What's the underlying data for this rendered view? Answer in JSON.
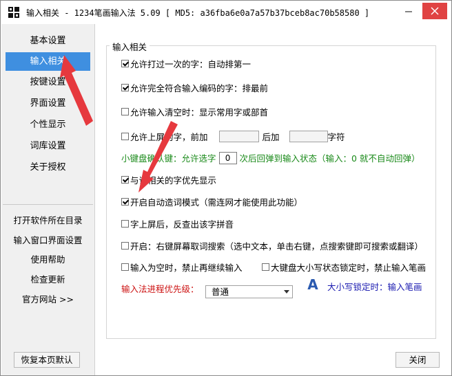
{
  "window": {
    "title": "输入相关 - 1234笔画输入法 5.09  [ MD5: a36fba6e0a7a57b37bceb8ac70b58580 ]"
  },
  "sidebar": {
    "items": [
      {
        "label": "基本设置"
      },
      {
        "label": "输入相关"
      },
      {
        "label": "按键设置"
      },
      {
        "label": "界面设置"
      },
      {
        "label": "个性显示"
      },
      {
        "label": "词库设置"
      },
      {
        "label": "关于授权"
      }
    ],
    "actions": [
      {
        "label": "打开软件所在目录"
      },
      {
        "label": "输入窗口界面设置"
      },
      {
        "label": "使用帮助"
      },
      {
        "label": "检查更新"
      },
      {
        "label": "官方网站 >>"
      }
    ]
  },
  "group": {
    "legend": "输入相关",
    "options": {
      "o1": {
        "label": "允许打过一次的字：自动排第一",
        "checked": true
      },
      "o2": {
        "label": "允许完全符合输入编码的字：排最前",
        "checked": true
      },
      "o3": {
        "label": "允许输入清空时：显示常用字或部首",
        "checked": false
      },
      "o4": {
        "label": "允许上屏的字，前加",
        "checked": false,
        "mid_label": "后加",
        "end_label": "字符"
      },
      "o5": {
        "label": "与词相关的字优先显示",
        "checked": true
      },
      "o6": {
        "label": "开启自动造词模式（需连网才能使用此功能）",
        "checked": true
      },
      "o7": {
        "label": "字上屏后，反查出该字拼音",
        "checked": false
      },
      "o8": {
        "label": "开启：右键屏幕取词搜索（选中文本，单击右键，点搜索键即可搜索或翻译）",
        "checked": false
      },
      "o9": {
        "label": "输入为空时，禁止再继续输入",
        "checked": false
      },
      "o10": {
        "label": "大键盘大小写状态锁定时，禁止输入笔画",
        "checked": false
      }
    },
    "keypad": {
      "prefix": "小键盘确认键：允许选字",
      "value": "0",
      "suffix": "次后回弹到输入状态（输入：0 就不自动回弹）"
    },
    "priority": {
      "label": "输入法进程优先级：",
      "selected": "普通"
    },
    "caps_lock_hint": "大小写锁定时：输入笔画"
  },
  "footer": {
    "reset_label": "恢复本页默认",
    "close_label": "关闭"
  },
  "colors": {
    "accent": "#3f8fe0",
    "arrow": "#e6393e",
    "green_text": "#1a8a1a",
    "red_text": "#cc1111",
    "blue_text": "#1a1ab0"
  }
}
